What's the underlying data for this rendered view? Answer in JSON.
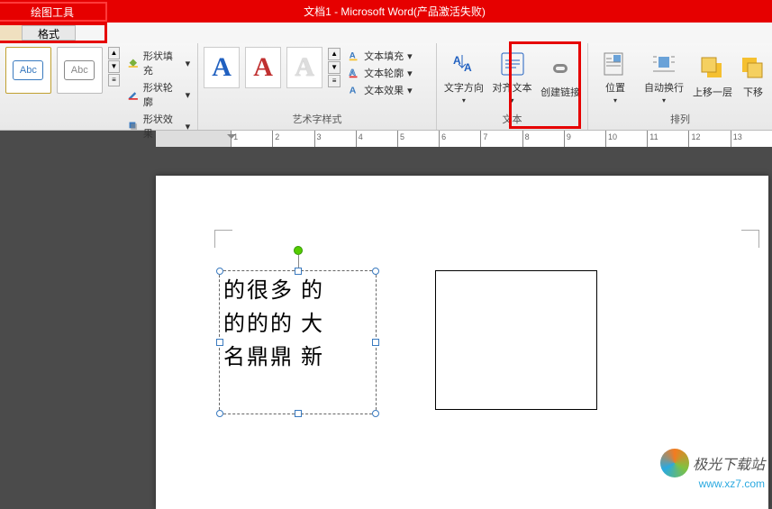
{
  "title": {
    "tool_tab": "绘图工具",
    "doc": "文档1 - Microsoft Word(产品激活失败)"
  },
  "tabs": {
    "format": "格式"
  },
  "ribbon": {
    "shape_label": "Abc",
    "shape_fill": "形状填充",
    "shape_outline": "形状轮廓",
    "shape_effects": "形状效果",
    "wordart_group": "艺术字样式",
    "wa_letter": "A",
    "text_fill": "文本填充",
    "text_outline": "文本轮廓",
    "text_effects": "文本效果",
    "text_direction": "文字方向",
    "align_text": "对齐文本",
    "create_link": "创建链接",
    "text_group": "文本",
    "position": "位置",
    "wrap_text": "自动换行",
    "bring_forward": "上移一层",
    "send_backward": "下移",
    "arrange_group": "排列"
  },
  "ruler": [
    "1",
    "2",
    "3",
    "4",
    "5",
    "6",
    "7",
    "8",
    "9",
    "10",
    "11",
    "12",
    "13"
  ],
  "doc": {
    "line1": "的很多 的",
    "line2": "的的的 大",
    "line3": "名鼎鼎 新"
  },
  "watermark": {
    "name": "极光下载站",
    "url": "www.xz7.com"
  }
}
